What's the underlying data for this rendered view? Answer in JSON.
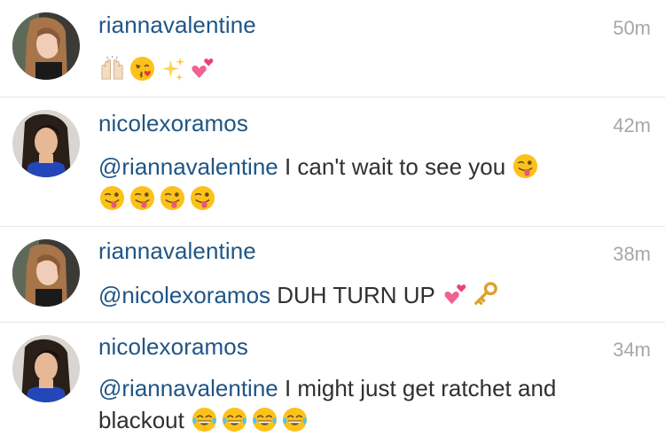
{
  "comments": [
    {
      "username": "riannavalentine",
      "time": "50m",
      "mention": "",
      "text": "",
      "emojis": [
        "raised-hands-icon",
        "kissing-face-icon",
        "sparkles-icon",
        "two-hearts-icon"
      ]
    },
    {
      "username": "nicolexoramos",
      "time": "42m",
      "mention": "@riannavalentine",
      "text": " I can't wait to see you ",
      "emojis": [
        "winking-tongue-face-icon",
        "winking-tongue-face-icon",
        "winking-tongue-face-icon",
        "winking-tongue-face-icon",
        "winking-tongue-face-icon"
      ]
    },
    {
      "username": "riannavalentine",
      "time": "38m",
      "mention": "@nicolexoramos",
      "text": " DUH TURN UP ",
      "emojis": [
        "two-hearts-icon",
        "key-icon"
      ]
    },
    {
      "username": "nicolexoramos",
      "time": "34m",
      "mention": "@riannavalentine",
      "text": " I might just get ratchet and blackout ",
      "emojis": [
        "tears-of-joy-face-icon",
        "tears-of-joy-face-icon",
        "tears-of-joy-face-icon",
        "tears-of-joy-face-icon"
      ]
    }
  ],
  "colors": {
    "username": "#1f5585",
    "mention": "#1f5585",
    "body_text": "#303030",
    "timestamp": "#a7a7a7",
    "divider": "#e6e6e6"
  }
}
